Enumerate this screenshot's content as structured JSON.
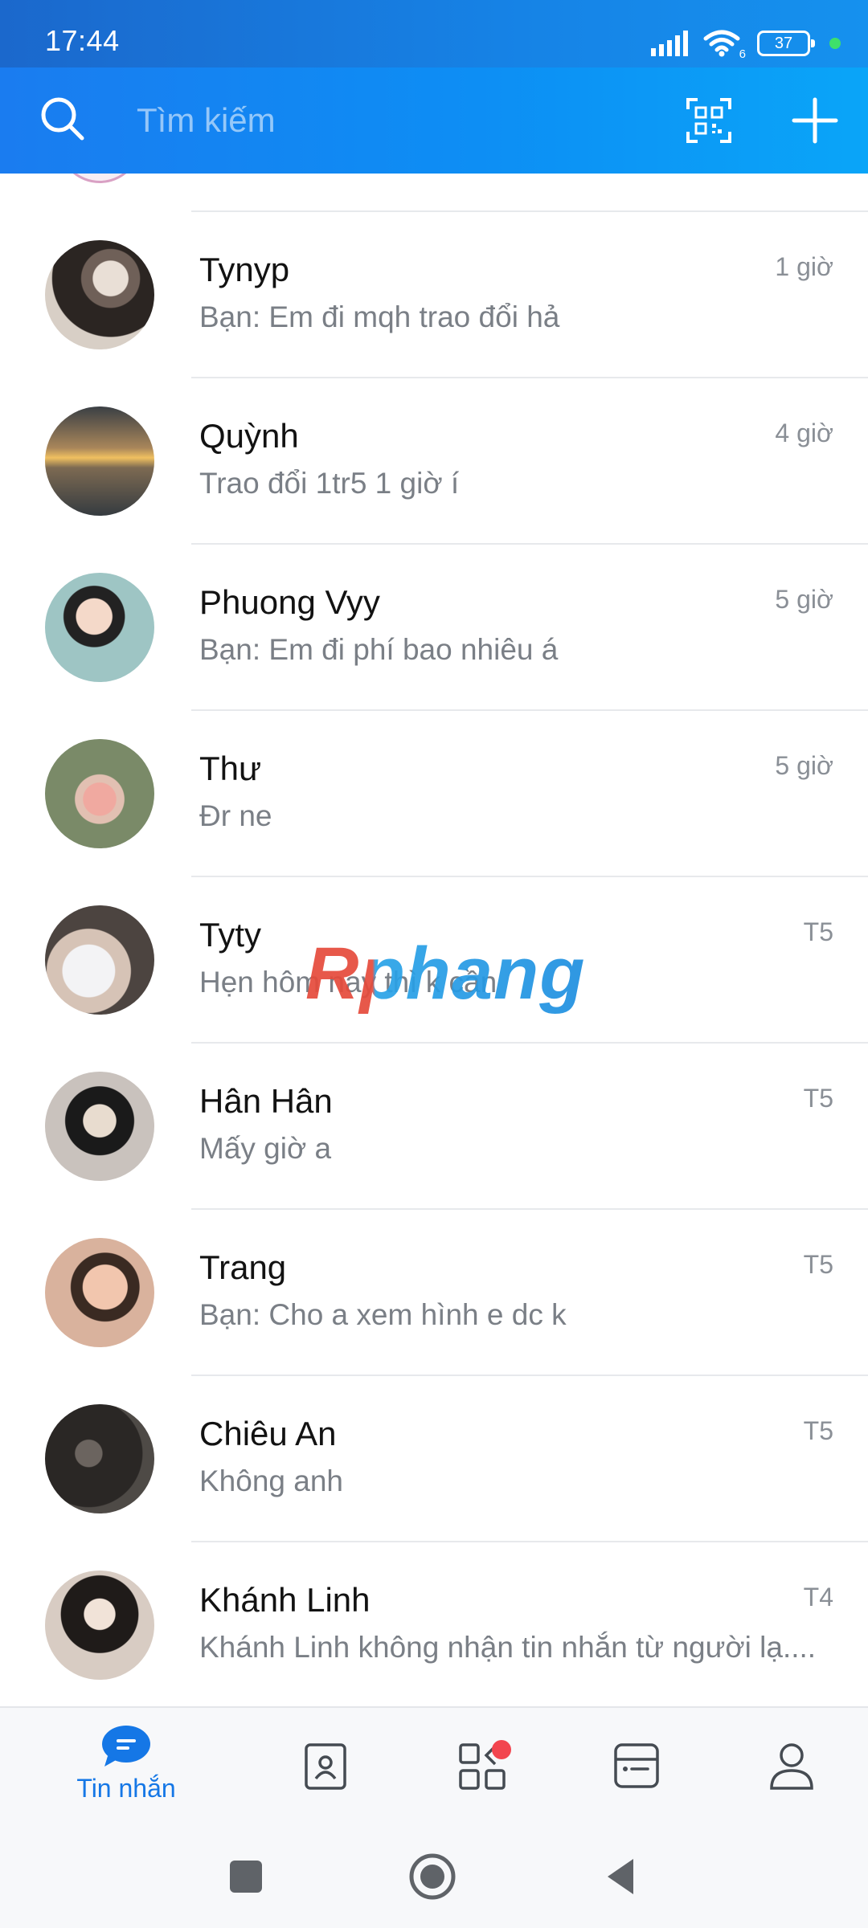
{
  "status_bar": {
    "time": "17:44",
    "battery": "37",
    "network_badge": "6",
    "icons": [
      "signal-icon",
      "wifi-icon",
      "battery-icon",
      "notification-dot"
    ]
  },
  "search": {
    "placeholder": "Tìm kiếm",
    "icons": [
      "search-icon",
      "qr-scan-icon",
      "plus-icon"
    ]
  },
  "conversations": [
    {
      "name": "Tynyp",
      "preview": "Bạn: Em đi mqh trao đổi hả",
      "time": "1 giờ"
    },
    {
      "name": "Quỳnh",
      "preview": "Trao đổi 1tr5 1 giờ í",
      "time": "4 giờ"
    },
    {
      "name": "Phuong Vyy",
      "preview": "Bạn: Em đi phí bao nhiêu á",
      "time": "5 giờ"
    },
    {
      "name": "Thư",
      "preview": "Đr ne",
      "time": "5 giờ"
    },
    {
      "name": "Tyty",
      "preview": "Hẹn hôm nay thì k cần",
      "time": "T5"
    },
    {
      "name": "Hân Hân",
      "preview": "Mấy giờ a",
      "time": "T5"
    },
    {
      "name": "Trang",
      "preview": "Bạn: Cho a xem hình e dc k",
      "time": "T5"
    },
    {
      "name": "Chiêu An",
      "preview": "Không anh",
      "time": "T5"
    },
    {
      "name": "Khánh Linh",
      "preview": "Khánh Linh không nhận tin nhắn từ người lạ....",
      "time": "T4"
    }
  ],
  "watermark": "Rphang",
  "bottom_nav": {
    "active_label": "Tin nhắn",
    "active_color": "#1577e6",
    "items": [
      "messages-icon",
      "contacts-icon",
      "discover-icon",
      "timeline-icon",
      "profile-icon"
    ]
  },
  "system_nav": [
    "recent-apps-icon",
    "home-icon",
    "back-icon"
  ],
  "colors": {
    "header_start": "#1a7cf0",
    "header_end": "#0aa5f8",
    "badge_red": "#f2454f"
  }
}
